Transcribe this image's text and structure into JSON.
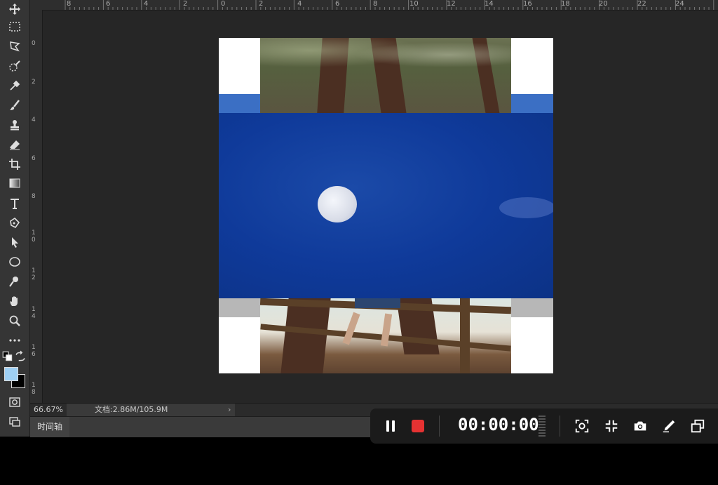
{
  "ruler_top": {
    "labels": [
      "8",
      "6",
      "4",
      "2",
      "0",
      "2",
      "4",
      "6",
      "8",
      "10",
      "12",
      "14",
      "16",
      "18",
      "20",
      "22",
      "24"
    ]
  },
  "ruler_left": {
    "labels": [
      "0",
      "2",
      "4",
      "6",
      "8",
      "10",
      "12",
      "14",
      "16",
      "18"
    ]
  },
  "status": {
    "zoom": "66.67%",
    "doc_info": "文档:2.86M/105.9M",
    "arrow": "›"
  },
  "timeline": {
    "tab_label": "时间轴"
  },
  "recorder": {
    "timer": "00:00:00",
    "icons": [
      "pause-icon",
      "stop-icon",
      "screenshot-region-icon",
      "collapse-icon",
      "camera-icon",
      "pen-icon",
      "window-icon"
    ]
  },
  "colors": {
    "foreground": "#9fd0f4",
    "background": "#000000",
    "stop": "#e63232"
  }
}
